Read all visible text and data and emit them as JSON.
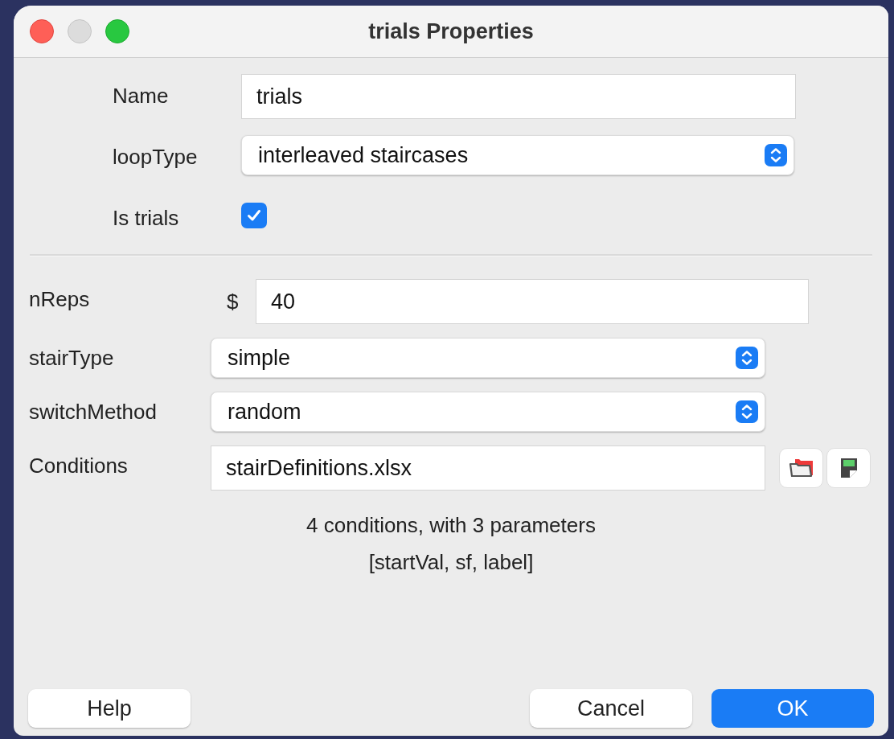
{
  "window": {
    "title": "trials Properties"
  },
  "top_fields": [
    {
      "kind": "text",
      "label": "Name",
      "value": "trials"
    },
    {
      "kind": "select",
      "label": "loopType",
      "value": "interleaved staircases"
    },
    {
      "kind": "checkbox",
      "label": "Is trials",
      "checked": true
    }
  ],
  "fields": [
    {
      "kind": "text",
      "label": "nReps",
      "prefix": "$",
      "value": "40"
    },
    {
      "kind": "select",
      "label": "stairType",
      "value": "simple"
    },
    {
      "kind": "select",
      "label": "switchMethod",
      "value": "random"
    },
    {
      "kind": "file",
      "label": "Conditions",
      "value": "stairDefinitions.xlsx"
    }
  ],
  "conditions_info": [
    "4 conditions, with 3 parameters",
    "[startVal, sf, label]"
  ],
  "buttons": [
    {
      "label": "Help",
      "kind": "plain"
    },
    {
      "label": "Cancel",
      "kind": "plain"
    },
    {
      "label": "OK",
      "kind": "default"
    }
  ]
}
